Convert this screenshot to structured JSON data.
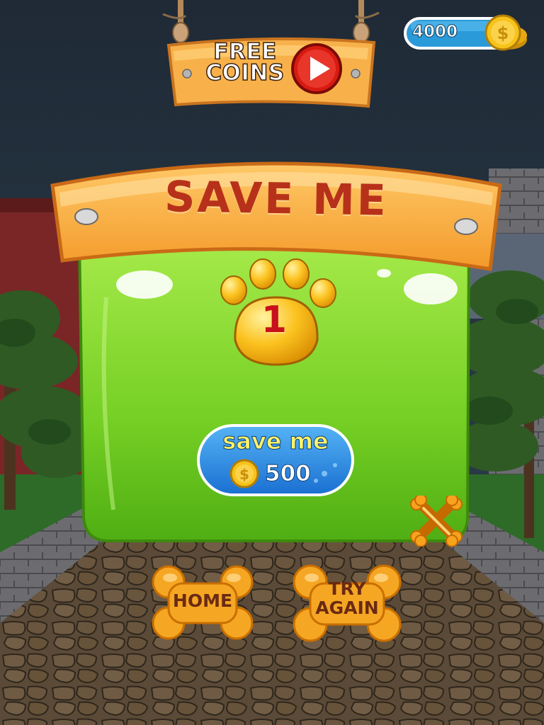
{
  "top_bar": {
    "free_coins_label": "FREE COINS",
    "coin_balance": "4000"
  },
  "panel": {
    "title": "SAVE ME",
    "lives_remaining": "1",
    "save_me_button": {
      "label": "save me",
      "cost": "500"
    }
  },
  "bottom_buttons": {
    "home_label": "HOME",
    "try_again_label": "TRY AGAIN"
  },
  "icons": [
    "play-icon",
    "coin-icon",
    "paw-icon",
    "close-icon",
    "bone-icon"
  ],
  "colors": {
    "sky": "#23323f",
    "wood": "#f4a640",
    "panel_green": "#7bd52b",
    "title_red": "#b7311a",
    "button_blue": "#2d8de6",
    "coin_gold": "#f7c21a",
    "bone_orange": "#f5a623"
  }
}
